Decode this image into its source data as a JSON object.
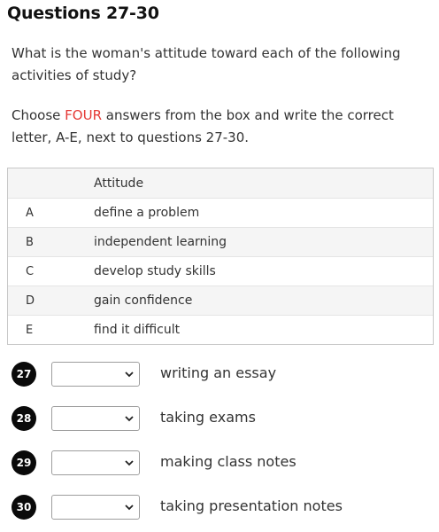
{
  "title": "Questions 27-30",
  "intro": "What is the woman's attitude toward each of the following activities of study?",
  "instruction": {
    "before": "Choose ",
    "highlight": "FOUR",
    "after": " answers from the box and write the correct letter, A-E, next to questions 27-30."
  },
  "colors": {
    "highlight": "#e53935",
    "badge": "#0a0a0a"
  },
  "table": {
    "header": "Attitude",
    "rows": [
      {
        "letter": "A",
        "text": "define a problem"
      },
      {
        "letter": "B",
        "text": "independent learning"
      },
      {
        "letter": "C",
        "text": "develop study skills"
      },
      {
        "letter": "D",
        "text": "gain confidence"
      },
      {
        "letter": "E",
        "text": "find it difficult"
      }
    ]
  },
  "questions": [
    {
      "number": "27",
      "selected": "",
      "label": "writing an essay"
    },
    {
      "number": "28",
      "selected": "",
      "label": "taking exams"
    },
    {
      "number": "29",
      "selected": "",
      "label": "making class notes"
    },
    {
      "number": "30",
      "selected": "",
      "label": "taking presentation notes"
    }
  ],
  "icons": {
    "dropdown": "chevron-down-icon"
  }
}
